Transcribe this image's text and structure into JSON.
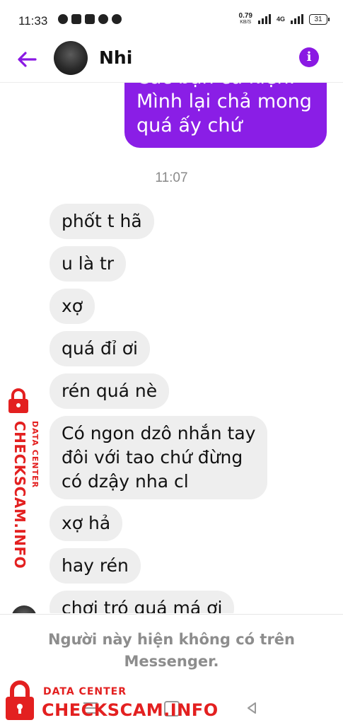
{
  "status_bar": {
    "time": "11:33",
    "net_speed": "0.79",
    "net_speed_unit": "KB/S",
    "network": "4G",
    "battery": "31"
  },
  "header": {
    "contact_name": "Nhi",
    "accent_color": "#8a19e3"
  },
  "chat": {
    "outgoing_lines": [
      "Các bạn cũ kiện.",
      "Mình lại chả mong",
      "quá ấy chứ"
    ],
    "timestamp": "11:07",
    "incoming": [
      {
        "lines": [
          "phốt t hã"
        ]
      },
      {
        "lines": [
          "u là tr"
        ]
      },
      {
        "lines": [
          "xợ"
        ]
      },
      {
        "lines": [
          "quá đỉ ơi"
        ]
      },
      {
        "lines": [
          "rén quá nè"
        ]
      },
      {
        "lines": [
          "Có ngon dzô nhắn tay",
          "đôi với tao chứ đừng",
          "có dzậy nha cl"
        ]
      },
      {
        "lines": [
          "xợ hả"
        ]
      },
      {
        "lines": [
          "hay rén"
        ]
      },
      {
        "lines": [
          "chơi tró quá má ơi"
        ]
      }
    ]
  },
  "footer": {
    "notice": "Người này hiện không có trên Messenger."
  },
  "watermark": {
    "small": "DATA CENTER",
    "big": "CHECKSCAM.INFO",
    "color": "#e32020"
  }
}
